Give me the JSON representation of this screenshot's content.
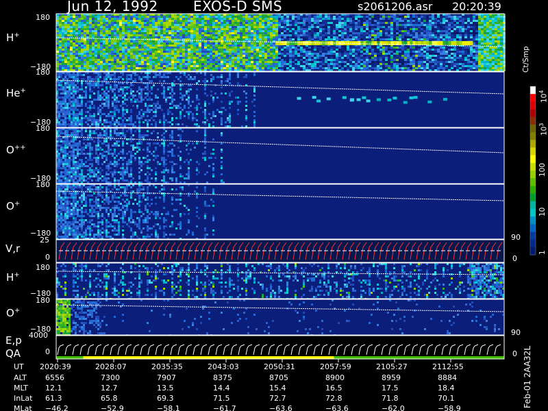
{
  "header": {
    "date": "Jun 12, 1992",
    "instrument": "EXOS-D SMS",
    "file": "s2061206.asr",
    "time": "20:20:39"
  },
  "panels": {
    "h_plus_top": {
      "label": "H",
      "sup": "+",
      "ymax": "180",
      "ymin": "−180"
    },
    "he_plus": {
      "label": "He",
      "sup": "+",
      "ymax": "180",
      "ymin": "−180"
    },
    "o_plus_plus": {
      "label": "O",
      "sup": "++",
      "ymax": "180",
      "ymin": "−180"
    },
    "o_plus": {
      "label": "O",
      "sup": "+",
      "ymax": "180",
      "ymin": "−180"
    },
    "vr": {
      "label": "V,r",
      "ymax": "25",
      "ymid": "0",
      "right_top": "90",
      "right_bottom": "0"
    },
    "h_plus_low": {
      "label": "H",
      "sup": "+",
      "ymax": "180",
      "ymin": "−180"
    },
    "o_plus_low": {
      "label": "O",
      "sup": "+",
      "ymax": "180",
      "ymin": "−180",
      "right_bottom": "90"
    },
    "ep": {
      "label_top": "E,p",
      "label_bottom": "QA",
      "ymax": "4000",
      "ymid": "0",
      "right": "0"
    }
  },
  "colorbar": {
    "unit": "Ct/Smp",
    "ticks": [
      {
        "base": "10",
        "exp": "4"
      },
      {
        "base": "10",
        "exp": "3"
      },
      {
        "base": "100",
        "exp": ""
      },
      {
        "base": "10",
        "exp": ""
      },
      {
        "base": "1",
        "exp": ""
      }
    ],
    "colors": [
      "#ffffff",
      "#ff0000",
      "#e00000",
      "#b00000",
      "#8a2c00",
      "#6e6400",
      "#808000",
      "#aaaa00",
      "#d8d800",
      "#ffff00",
      "#c8e000",
      "#96d200",
      "#60c000",
      "#28b000",
      "#00a030",
      "#00b4a0",
      "#00c8c8",
      "#0090c8",
      "#0064c8",
      "#003ca0",
      "#00288c",
      "#001a6e"
    ]
  },
  "footer_id": "Feb-01 2AA32L",
  "ephemeris": {
    "labels": [
      "UT",
      "ALT",
      "MLT",
      "InLat",
      "MLat"
    ],
    "columns": [
      [
        "2020:39",
        "6556",
        "12.1",
        "61.3",
        "−46.2"
      ],
      [
        "2028:07",
        "7300",
        "12.7",
        "65.8",
        "−52.9"
      ],
      [
        "2035:35",
        "7907",
        "13.5",
        "69.3",
        "−58.1"
      ],
      [
        "2043:03",
        "8375",
        "14.4",
        "71.5",
        "−61.7"
      ],
      [
        "2050:31",
        "8705",
        "15.4",
        "72.7",
        "−63.6"
      ],
      [
        "2057:59",
        "8900",
        "16.5",
        "72.8",
        "−63.6"
      ],
      [
        "2105:27",
        "8959",
        "17.5",
        "71.8",
        "−62.0"
      ],
      [
        "2112:55",
        "8884",
        "18.4",
        "70.1",
        "−58.9"
      ]
    ]
  },
  "chart_data": {
    "type": "heatmap",
    "time_axis": [
      "2020:39",
      "2028:07",
      "2035:35",
      "2043:03",
      "2050:31",
      "2057:59",
      "2105:27",
      "2112:55"
    ],
    "color_scale": "log",
    "color_range": [
      1,
      10000
    ],
    "series": [
      {
        "name": "H+",
        "ylim": [
          -180,
          180
        ]
      },
      {
        "name": "He+",
        "ylim": [
          -180,
          180
        ]
      },
      {
        "name": "O++",
        "ylim": [
          -180,
          180
        ]
      },
      {
        "name": "O+",
        "ylim": [
          -180,
          180
        ]
      },
      {
        "name": "V,r",
        "ylim": [
          0,
          25
        ]
      },
      {
        "name": "H+",
        "ylim": [
          -180,
          180
        ]
      },
      {
        "name": "O+",
        "ylim": [
          -180,
          180
        ]
      },
      {
        "name": "E,p",
        "ylim": [
          0,
          4000
        ]
      }
    ]
  }
}
